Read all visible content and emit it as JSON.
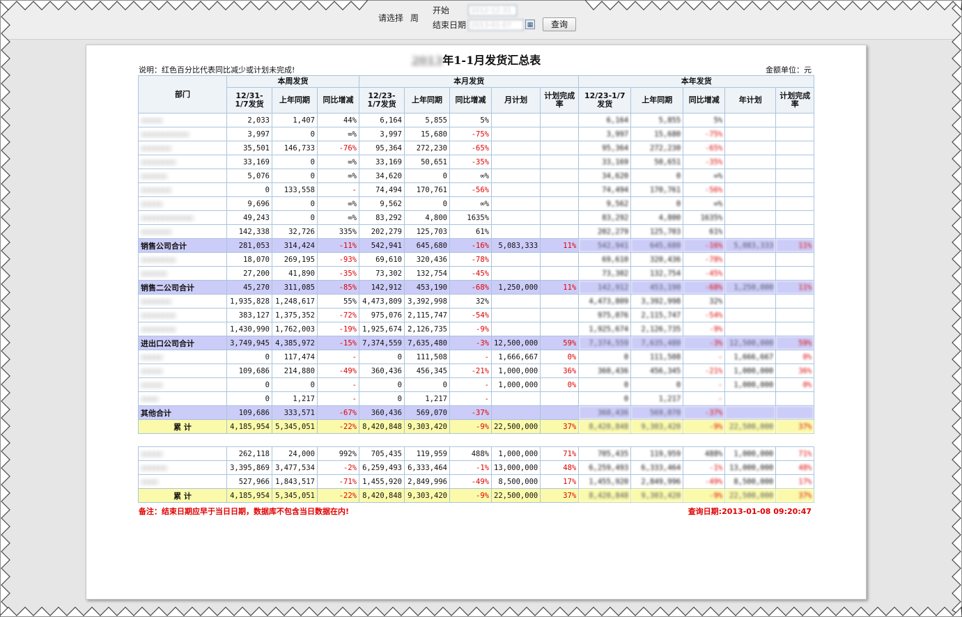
{
  "toolbar": {
    "select_label": "请选择",
    "week_label": "周",
    "start_label": "开始",
    "start_value": "2012-12-31",
    "end_label": "结束日期",
    "end_value": "2013-01-07",
    "query_button": "查询"
  },
  "report": {
    "title_year": "2013",
    "title_suffix": "年1-1月发货汇总表",
    "note": "说明：红色百分比代表同比减少或计划未完成!",
    "unit": "金额单位：元",
    "headers": {
      "dept": "部门",
      "week_group": "本周发货",
      "month_group": "本月发货",
      "year_group": "本年发货",
      "week_ship": "12/31-1/7发货",
      "last_year": "上年同期",
      "yoy": "同比增减",
      "month_ship": "12/23-1/7发货",
      "month_plan": "月计划",
      "plan_rate": "计划完成率",
      "year_ship": "12/23-1/7发货",
      "year_plan": "年计划"
    },
    "rows": [
      {
        "type": "row",
        "dept": "□□□□□",
        "c": [
          "2,033",
          "1,407",
          "44%",
          "6,164",
          "5,855",
          "5%",
          "",
          "",
          "6,164",
          "5,855",
          "5%",
          "",
          ""
        ]
      },
      {
        "type": "row",
        "dept": "□□□□□□□□□□□",
        "c": [
          "3,997",
          "0",
          "∞%",
          "3,997",
          "15,680",
          "-75%",
          "",
          "",
          "3,997",
          "15,680",
          "-75%",
          "",
          ""
        ]
      },
      {
        "type": "row",
        "dept": "□□□□□□□",
        "c": [
          "35,501",
          "146,733",
          "-76%",
          "95,364",
          "272,230",
          "-65%",
          "",
          "",
          "95,364",
          "272,230",
          "-65%",
          "",
          ""
        ]
      },
      {
        "type": "row",
        "dept": "□□□□□□□□",
        "c": [
          "33,169",
          "0",
          "∞%",
          "33,169",
          "50,651",
          "-35%",
          "",
          "",
          "33,169",
          "50,651",
          "-35%",
          "",
          ""
        ]
      },
      {
        "type": "row",
        "dept": "□□□□□□",
        "c": [
          "5,076",
          "0",
          "∞%",
          "34,620",
          "0",
          "∞%",
          "",
          "",
          "34,620",
          "0",
          "∞%",
          "",
          ""
        ]
      },
      {
        "type": "row",
        "dept": "□□□□□□□",
        "c": [
          "0",
          "133,558",
          "-",
          "74,494",
          "170,761",
          "-56%",
          "",
          "",
          "74,494",
          "170,761",
          "-56%",
          "",
          ""
        ]
      },
      {
        "type": "row",
        "dept": "□□□□□",
        "c": [
          "9,696",
          "0",
          "∞%",
          "9,562",
          "0",
          "∞%",
          "",
          "",
          "9,562",
          "0",
          "∞%",
          "",
          ""
        ]
      },
      {
        "type": "row",
        "dept": "□□□□□□□□□□□□",
        "c": [
          "49,243",
          "0",
          "∞%",
          "83,292",
          "4,800",
          "1635%",
          "",
          "",
          "83,292",
          "4,800",
          "1635%",
          "",
          ""
        ]
      },
      {
        "type": "row",
        "dept": "□□□□□□□",
        "c": [
          "142,338",
          "32,726",
          "335%",
          "202,279",
          "125,703",
          "61%",
          "",
          "",
          "202,279",
          "125,703",
          "61%",
          "",
          ""
        ]
      },
      {
        "type": "sub",
        "dept": "销售公司合计",
        "c": [
          "281,053",
          "314,424",
          "-11%",
          "542,941",
          "645,680",
          "-16%",
          "5,083,333",
          "11%",
          "542,941",
          "645,680",
          "-16%",
          "5,083,333",
          "11%"
        ]
      },
      {
        "type": "row",
        "dept": "□□□□□□□□",
        "c": [
          "18,070",
          "269,195",
          "-93%",
          "69,610",
          "320,436",
          "-78%",
          "",
          "",
          "69,610",
          "320,436",
          "-78%",
          "",
          ""
        ]
      },
      {
        "type": "row",
        "dept": "□□□□□□",
        "c": [
          "27,200",
          "41,890",
          "-35%",
          "73,302",
          "132,754",
          "-45%",
          "",
          "",
          "73,302",
          "132,754",
          "-45%",
          "",
          ""
        ]
      },
      {
        "type": "sub",
        "dept": "销售二公司合计",
        "c": [
          "45,270",
          "311,085",
          "-85%",
          "142,912",
          "453,190",
          "-68%",
          "1,250,000",
          "11%",
          "142,912",
          "453,190",
          "-68%",
          "1,250,000",
          "11%"
        ]
      },
      {
        "type": "row",
        "dept": "□□□□□□□",
        "c": [
          "1,935,828",
          "1,248,617",
          "55%",
          "4,473,809",
          "3,392,998",
          "32%",
          "",
          "",
          "4,473,809",
          "3,392,998",
          "32%",
          "",
          ""
        ]
      },
      {
        "type": "row",
        "dept": "□□□□□□□□",
        "c": [
          "383,127",
          "1,375,352",
          "-72%",
          "975,076",
          "2,115,747",
          "-54%",
          "",
          "",
          "975,076",
          "2,115,747",
          "-54%",
          "",
          ""
        ]
      },
      {
        "type": "row",
        "dept": "□□□□□□□□",
        "c": [
          "1,430,990",
          "1,762,003",
          "-19%",
          "1,925,674",
          "2,126,735",
          "-9%",
          "",
          "",
          "1,925,674",
          "2,126,735",
          "-9%",
          "",
          ""
        ]
      },
      {
        "type": "sub",
        "dept": "进出口公司合计",
        "c": [
          "3,749,945",
          "4,385,972",
          "-15%",
          "7,374,559",
          "7,635,480",
          "-3%",
          "12,500,000",
          "59%",
          "7,374,559",
          "7,635,480",
          "-3%",
          "12,500,000",
          "59%"
        ]
      },
      {
        "type": "row",
        "dept": "□□□□□",
        "c": [
          "0",
          "117,474",
          "-",
          "0",
          "111,508",
          "-",
          "1,666,667",
          "0%",
          "0",
          "111,508",
          "-",
          "1,666,667",
          "0%"
        ]
      },
      {
        "type": "row",
        "dept": "□□□□□",
        "c": [
          "109,686",
          "214,880",
          "-49%",
          "360,436",
          "456,345",
          "-21%",
          "1,000,000",
          "36%",
          "360,436",
          "456,345",
          "-21%",
          "1,000,000",
          "36%"
        ]
      },
      {
        "type": "row",
        "dept": "□□□□□",
        "c": [
          "0",
          "0",
          "-",
          "0",
          "0",
          "-",
          "1,000,000",
          "0%",
          "0",
          "0",
          "-",
          "1,000,000",
          "0%"
        ]
      },
      {
        "type": "row",
        "dept": "□□□□",
        "c": [
          "0",
          "1,217",
          "-",
          "0",
          "1,217",
          "-",
          "",
          "",
          "0",
          "1,217",
          "-",
          "",
          ""
        ]
      },
      {
        "type": "sub",
        "dept": "其他合计",
        "c": [
          "109,686",
          "333,571",
          "-67%",
          "360,436",
          "569,070",
          "-37%",
          "",
          "",
          "360,436",
          "569,070",
          "-37%",
          "",
          ""
        ]
      },
      {
        "type": "tot",
        "dept": "累 计",
        "c": [
          "4,185,954",
          "5,345,051",
          "-22%",
          "8,420,848",
          "9,303,420",
          "-9%",
          "22,500,000",
          "37%",
          "8,420,848",
          "9,303,420",
          "-9%",
          "22,500,000",
          "37%"
        ]
      },
      {
        "type": "gap"
      },
      {
        "type": "row",
        "dept": "□□□□□",
        "c": [
          "262,118",
          "24,000",
          "992%",
          "705,435",
          "119,959",
          "488%",
          "1,000,000",
          "71%",
          "705,435",
          "119,959",
          "488%",
          "1,000,000",
          "71%"
        ]
      },
      {
        "type": "row",
        "dept": "□□□□□□",
        "c": [
          "3,395,869",
          "3,477,534",
          "-2%",
          "6,259,493",
          "6,333,464",
          "-1%",
          "13,000,000",
          "48%",
          "6,259,493",
          "6,333,464",
          "-1%",
          "13,000,000",
          "48%"
        ]
      },
      {
        "type": "row",
        "dept": "□□□□",
        "c": [
          "527,966",
          "1,843,517",
          "-71%",
          "1,455,920",
          "2,849,996",
          "-49%",
          "8,500,000",
          "17%",
          "1,455,920",
          "2,849,996",
          "-49%",
          "8,500,000",
          "17%"
        ]
      },
      {
        "type": "tot",
        "dept": "累 计",
        "c": [
          "4,185,954",
          "5,345,051",
          "-22%",
          "8,420,848",
          "9,303,420",
          "-9%",
          "22,500,000",
          "37%",
          "8,420,848",
          "9,303,420",
          "-9%",
          "22,500,000",
          "37%"
        ]
      }
    ],
    "remark": "备注：结束日期应早于当日日期，数据库不包含当日数据在内!",
    "query_date": "查询日期:2013-01-08 09:20:47"
  },
  "colors": {
    "negative": "#e00000",
    "subtotal_bg": "#ccccf8",
    "total_bg": "#fafaaa",
    "grid": "#a9c4dd"
  }
}
